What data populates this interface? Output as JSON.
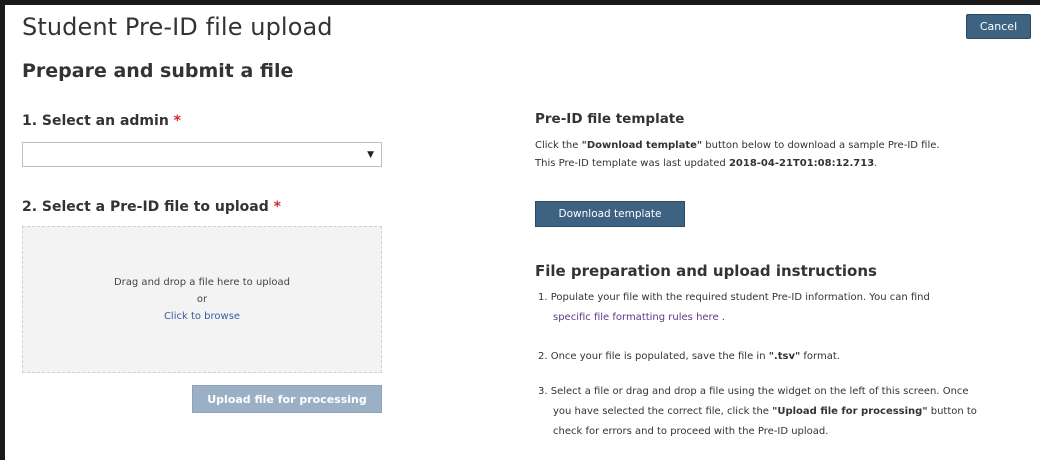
{
  "header": {
    "title": "Student Pre-ID file upload",
    "subtitle": "Prepare and submit a file",
    "cancel_label": "Cancel"
  },
  "left": {
    "step1": {
      "label": "1. Select an admin ",
      "required_mark": "*",
      "select_value": ""
    },
    "step2": {
      "label": "2. Select a Pre-ID file to upload ",
      "required_mark": "*"
    },
    "dropzone": {
      "line1": "Drag and drop a file here to upload",
      "line2": "or",
      "browse_link": "Click to browse"
    },
    "upload_button": "Upload file for processing"
  },
  "right": {
    "template": {
      "heading": "Pre-ID file template",
      "line1_pre": "Click the ",
      "line1_bold": "\"Download template\"",
      "line1_post": " button below to download a sample Pre-ID file.",
      "line2_pre": "This Pre-ID template was last updated ",
      "line2_bold": "2018-04-21T01:08:12.713",
      "line2_post": ".",
      "download_button": "Download template"
    },
    "instructions": {
      "heading": "File preparation and upload instructions",
      "item1_a": "1. Populate your file with the required student Pre-ID information. You can find",
      "item1_link": "specific file formatting rules here",
      "item1_post": " .",
      "item2_pre": "2. Once your file is populated, save the file in ",
      "item2_bold": "\".tsv\"",
      "item2_post": " format.",
      "item3_a": "3. Select a file or drag and drop a file using the widget on the left of this screen. Once",
      "item3_b_pre": "you have selected the correct file, click the ",
      "item3_b_bold": "\"Upload file for processing\"",
      "item3_b_post": " button to",
      "item3_c": "check for errors and to proceed with the Pre-ID upload."
    }
  }
}
